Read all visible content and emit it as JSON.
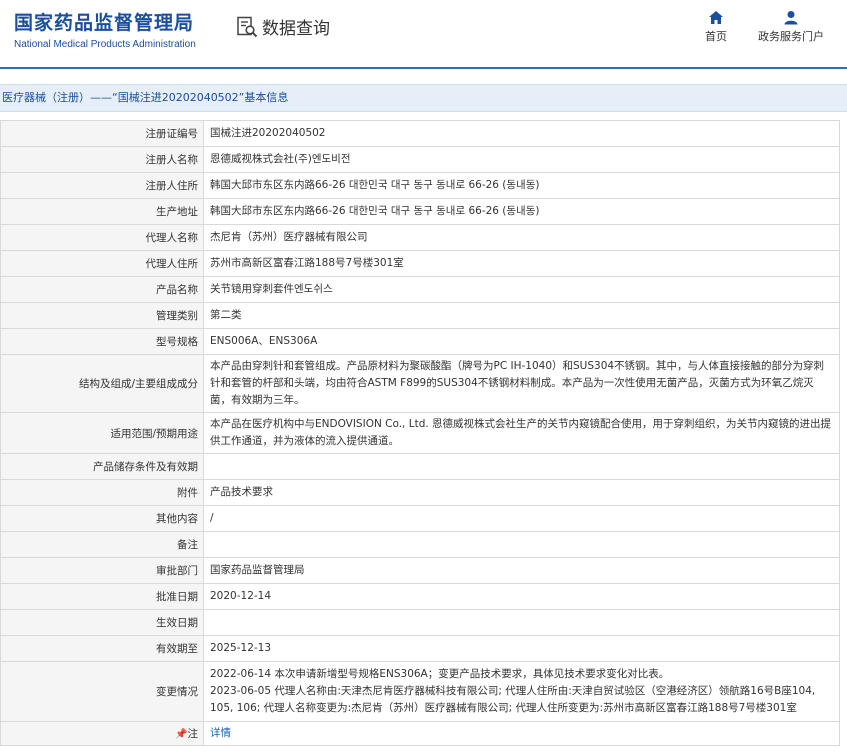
{
  "header": {
    "logo_cn": "国家药品监督管理局",
    "logo_en": "National Medical Products Administration",
    "query_label": "数据查询",
    "nav": [
      {
        "label": "首页",
        "icon": "home-icon"
      },
      {
        "label": "政务服务门户",
        "icon": "user-icon"
      }
    ]
  },
  "breadcrumb": "医疗器械（注册）——“国械注进20202040502”基本信息",
  "rows": [
    {
      "label": "注册证编号",
      "value": "国械注进20202040502"
    },
    {
      "label": "注册人名称",
      "value": "恩德威视株式会社(주)엔도비전"
    },
    {
      "label": "注册人住所",
      "value": "韩国大邱市东区东内路66-26 대한민국 대구 동구 동내로 66-26 (동내동)"
    },
    {
      "label": "生产地址",
      "value": "韩国大邱市东区东内路66-26 대한민국 대구 동구 동내로 66-26 (동내동)"
    },
    {
      "label": "代理人名称",
      "value": "杰尼肯（苏州）医疗器械有限公司"
    },
    {
      "label": "代理人住所",
      "value": "苏州市高新区富春江路188号7号楼301室"
    },
    {
      "label": "产品名称",
      "value": "关节镜用穿刺套件엔도쉬스"
    },
    {
      "label": "管理类别",
      "value": "第二类"
    },
    {
      "label": "型号规格",
      "value": "ENS006A、ENS306A"
    },
    {
      "label": "结构及组成/主要组成成分",
      "value": "本产品由穿刺针和套管组成。产品原材料为聚碳酸酯（牌号为PC IH-1040）和SUS304不锈钢。其中，与人体直接接触的部分为穿刺针和套管的杆部和头端，均由符合ASTM F899的SUS304不锈钢材料制成。本产品为一次性使用无菌产品，灭菌方式为环氧乙烷灭菌，有效期为三年。"
    },
    {
      "label": "适用范围/预期用途",
      "value": "本产品在医疗机构中与ENDOVISION Co., Ltd. 恩德威视株式会社生产的关节内窥镜配合使用，用于穿刺组织，为关节内窥镜的进出提供工作通道，并为液体的流入提供通道。"
    },
    {
      "label": "产品储存条件及有效期",
      "value": ""
    },
    {
      "label": "附件",
      "value": "产品技术要求"
    },
    {
      "label": "其他内容",
      "value": "/"
    },
    {
      "label": "备注",
      "value": ""
    },
    {
      "label": "审批部门",
      "value": "国家药品监督管理局"
    },
    {
      "label": "批准日期",
      "value": "2020-12-14"
    },
    {
      "label": "生效日期",
      "value": ""
    },
    {
      "label": "有效期至",
      "value": "2025-12-13"
    },
    {
      "label": "变更情况",
      "value": "2022-06-14 本次申请新增型号规格ENS306A；变更产品技术要求，具体见技术要求变化对比表。\n2023-06-05 代理人名称由:天津杰尼肯医疗器械科技有限公司; 代理人住所由:天津自贸试验区（空港经济区）领航路16号B座104, 105, 106; 代理人名称变更为:杰尼肯（苏州）医疗器械有限公司; 代理人住所变更为:苏州市高新区富春江路188号7号楼301室"
    }
  ],
  "footer_row": {
    "label": "注",
    "value": "详情"
  },
  "colors": {
    "brand": "#1a4fa0",
    "link": "#1a62b5",
    "label_bg": "#f5f5f5",
    "crumb_bg": "#e6eef7",
    "border": "#d9d9d9"
  }
}
